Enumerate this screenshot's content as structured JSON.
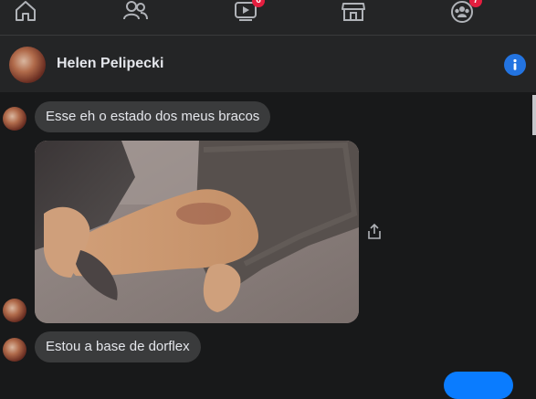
{
  "nav": {
    "icons": [
      "home-icon",
      "friends-icon",
      "watch-icon",
      "marketplace-icon",
      "groups-icon"
    ],
    "watch_badge": "6",
    "groups_badge": "7"
  },
  "header": {
    "name": "Helen Pelipecki"
  },
  "messages": [
    {
      "type": "text",
      "text": "Esse eh o estado dos meus bracos"
    },
    {
      "type": "image",
      "alt": ""
    },
    {
      "type": "text",
      "text": "Estou a base de dorflex"
    }
  ],
  "colors": {
    "background": "#18191a",
    "bubble": "#3a3b3c",
    "accent": "#2374e1",
    "sent": "#0a7cff",
    "badge": "#e41e3f"
  }
}
